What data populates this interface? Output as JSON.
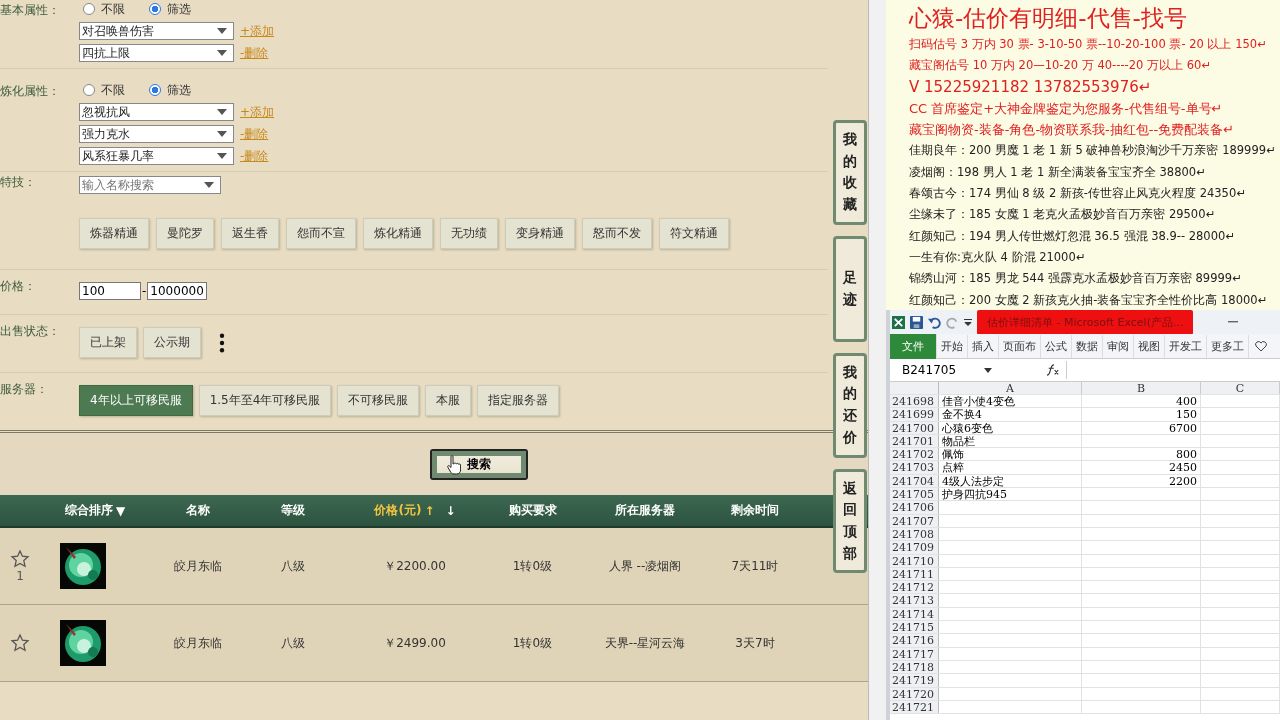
{
  "filters": {
    "basic": {
      "label": "基本属性：",
      "options": [
        {
          "label": "不限",
          "selected": false
        },
        {
          "label": "筛选",
          "selected": true
        }
      ],
      "selects": [
        {
          "value": "对召唤兽伤害",
          "action": "+添加"
        },
        {
          "value": "四抗上限",
          "action": "-删除"
        }
      ]
    },
    "refine": {
      "label": "炼化属性：",
      "options": [
        {
          "label": "不限",
          "selected": false
        },
        {
          "label": "筛选",
          "selected": true
        }
      ],
      "selects": [
        {
          "value": "忽视抗风",
          "action": "+添加"
        },
        {
          "value": "强力克水",
          "action": "-删除"
        },
        {
          "value": "风系狂暴几率",
          "action": "-删除"
        }
      ]
    },
    "skills": {
      "label": "特技：",
      "placeholder": "输入名称搜索",
      "buttons": [
        "炼器精通",
        "曼陀罗",
        "返生香",
        "怨而不宣",
        "炼化精通",
        "无功绩",
        "变身精通",
        "怒而不发",
        "符文精通"
      ]
    },
    "price": {
      "label": "价格：",
      "min": "100",
      "separator": "-",
      "max": "1000000"
    },
    "sale_status": {
      "label": "出售状态：",
      "buttons": [
        "已上架",
        "公示期"
      ]
    },
    "server": {
      "label": "服务器：",
      "buttons": [
        {
          "label": "4年以上可移民服",
          "selected": true
        },
        {
          "label": "1.5年至4年可移民服",
          "selected": false
        },
        {
          "label": "不可移民服",
          "selected": false
        },
        {
          "label": "本服",
          "selected": false
        },
        {
          "label": "指定服务器",
          "selected": false
        }
      ]
    }
  },
  "search_button": "搜索",
  "table": {
    "columns": [
      {
        "label": "综合排序",
        "sort_mark": "▼",
        "active": false
      },
      {
        "label": "名称",
        "active": false
      },
      {
        "label": "等级",
        "active": false
      },
      {
        "label": "价格(元)",
        "sort_up": "↑",
        "sort_down": "↓",
        "active": true
      },
      {
        "label": "购买要求",
        "active": false
      },
      {
        "label": "所在服务器",
        "active": false
      },
      {
        "label": "剩余时间",
        "active": false
      }
    ],
    "rows": [
      {
        "count": "1",
        "name": "皎月东临",
        "level": "八级",
        "price": "￥2200.00",
        "requirement": "1转0级",
        "server": "人界 --凌烟阁",
        "time_left": "7天11时"
      },
      {
        "name": "皎月东临",
        "level": "八级",
        "price": "￥2499.00",
        "requirement": "1转0级",
        "server": "天界--星河云海",
        "time_left": "3天7时"
      }
    ]
  },
  "side_tabs": [
    "我的收藏",
    "足迹",
    "我的还价",
    "返回顶部"
  ],
  "ad": {
    "title": "心猿-估价有明细-代售-找号",
    "lines": [
      {
        "text": "扫码估号 3 万内 30 票- 3-10-50 票--10-20-100 票- 20 以上 150↵",
        "color": "#e02020",
        "kind": "small"
      },
      {
        "text": "藏宝阁估号 10 万内 20—10-20 万 40----20 万以上 60↵",
        "color": "#e02020",
        "kind": "small"
      },
      {
        "text": "V 15225921182   13782553976↵",
        "color": "#e02020",
        "kind": "large"
      },
      {
        "text": "CC 首席鉴定+大神金牌鉴定为您服务-代售组号-单号↵",
        "color": "#e02020",
        "kind": "medium"
      },
      {
        "text": "藏宝阁物资-装备-角色-物资联系我-抽红包--免费配装备↵",
        "color": "#e02020",
        "kind": "medium"
      },
      {
        "text": "佳期良年：200 男魔 1 老 1 新 5 破神兽秒浪淘沙千万亲密 189999↵",
        "color": "#222222",
        "kind": "small"
      },
      {
        "text": "凌烟阁：198 男人 1 老 1 新全满装备宝宝齐全 38800↵",
        "color": "#222222",
        "kind": "small"
      },
      {
        "text": "春颂古今：174 男仙 8 级 2 新孩-传世容止风克火程度 24350↵",
        "color": "#222222",
        "kind": "small"
      },
      {
        "text": "尘缘未了：185 女魔 1 老克火孟极妙音百万亲密 29500↵",
        "color": "#222222",
        "kind": "small"
      },
      {
        "text": "红颜知己：194 男人传世燃灯忽混 36.5 强混 38.9-- 28000↵",
        "color": "#222222",
        "kind": "small"
      },
      {
        "text": "一生有你:克火队 4 阶混 21000↵",
        "color": "#222222",
        "kind": "small"
      },
      {
        "text": "锦绣山河：185 男龙 544 强霹克水孟极妙音百万亲密 89999↵",
        "color": "#222222",
        "kind": "small"
      },
      {
        "text": "红颜知己：200 女魔 2 新孩克火抽-装备宝宝齐全性价比高 18000↵",
        "color": "#222222",
        "kind": "small"
      }
    ]
  },
  "excel": {
    "title": "估价详细清单 - Microsoft Excel(产品...",
    "tabs": [
      {
        "label": "文件",
        "selected": true
      },
      {
        "label": "开始",
        "selected": false
      },
      {
        "label": "插入",
        "selected": false
      },
      {
        "label": "页面布",
        "selected": false
      },
      {
        "label": "公式",
        "selected": false
      },
      {
        "label": "数据",
        "selected": false
      },
      {
        "label": "审阅",
        "selected": false
      },
      {
        "label": "视图",
        "selected": false
      },
      {
        "label": "开发工",
        "selected": false
      },
      {
        "label": "更多工",
        "selected": false
      }
    ],
    "name_box": "B241705",
    "columns": [
      "A",
      "B",
      "C"
    ],
    "rows": [
      {
        "number": "241698",
        "a": "佳音小使4变色",
        "b": "400"
      },
      {
        "number": "241699",
        "a": "金不换4",
        "b": "150"
      },
      {
        "number": "241700",
        "a": "心猿6变色",
        "b": "6700"
      },
      {
        "number": "241701",
        "a": "物品栏"
      },
      {
        "number": "241702",
        "a": "佩饰",
        "b": "800"
      },
      {
        "number": "241703",
        "a": "点粹",
        "b": "2450"
      },
      {
        "number": "241704",
        "a": "4级人法步定",
        "b": "2200"
      },
      {
        "number": "241705",
        "a": "护身四抗945"
      },
      {
        "number": "241706"
      },
      {
        "number": "241707"
      },
      {
        "number": "241708"
      },
      {
        "number": "241709"
      },
      {
        "number": "241710"
      },
      {
        "number": "241711"
      },
      {
        "number": "241712"
      },
      {
        "number": "241713"
      },
      {
        "number": "241714"
      },
      {
        "number": "241715"
      },
      {
        "number": "241716"
      },
      {
        "number": "241717"
      },
      {
        "number": "241718"
      },
      {
        "number": "241719"
      },
      {
        "number": "241720"
      },
      {
        "number": "241721"
      }
    ]
  }
}
